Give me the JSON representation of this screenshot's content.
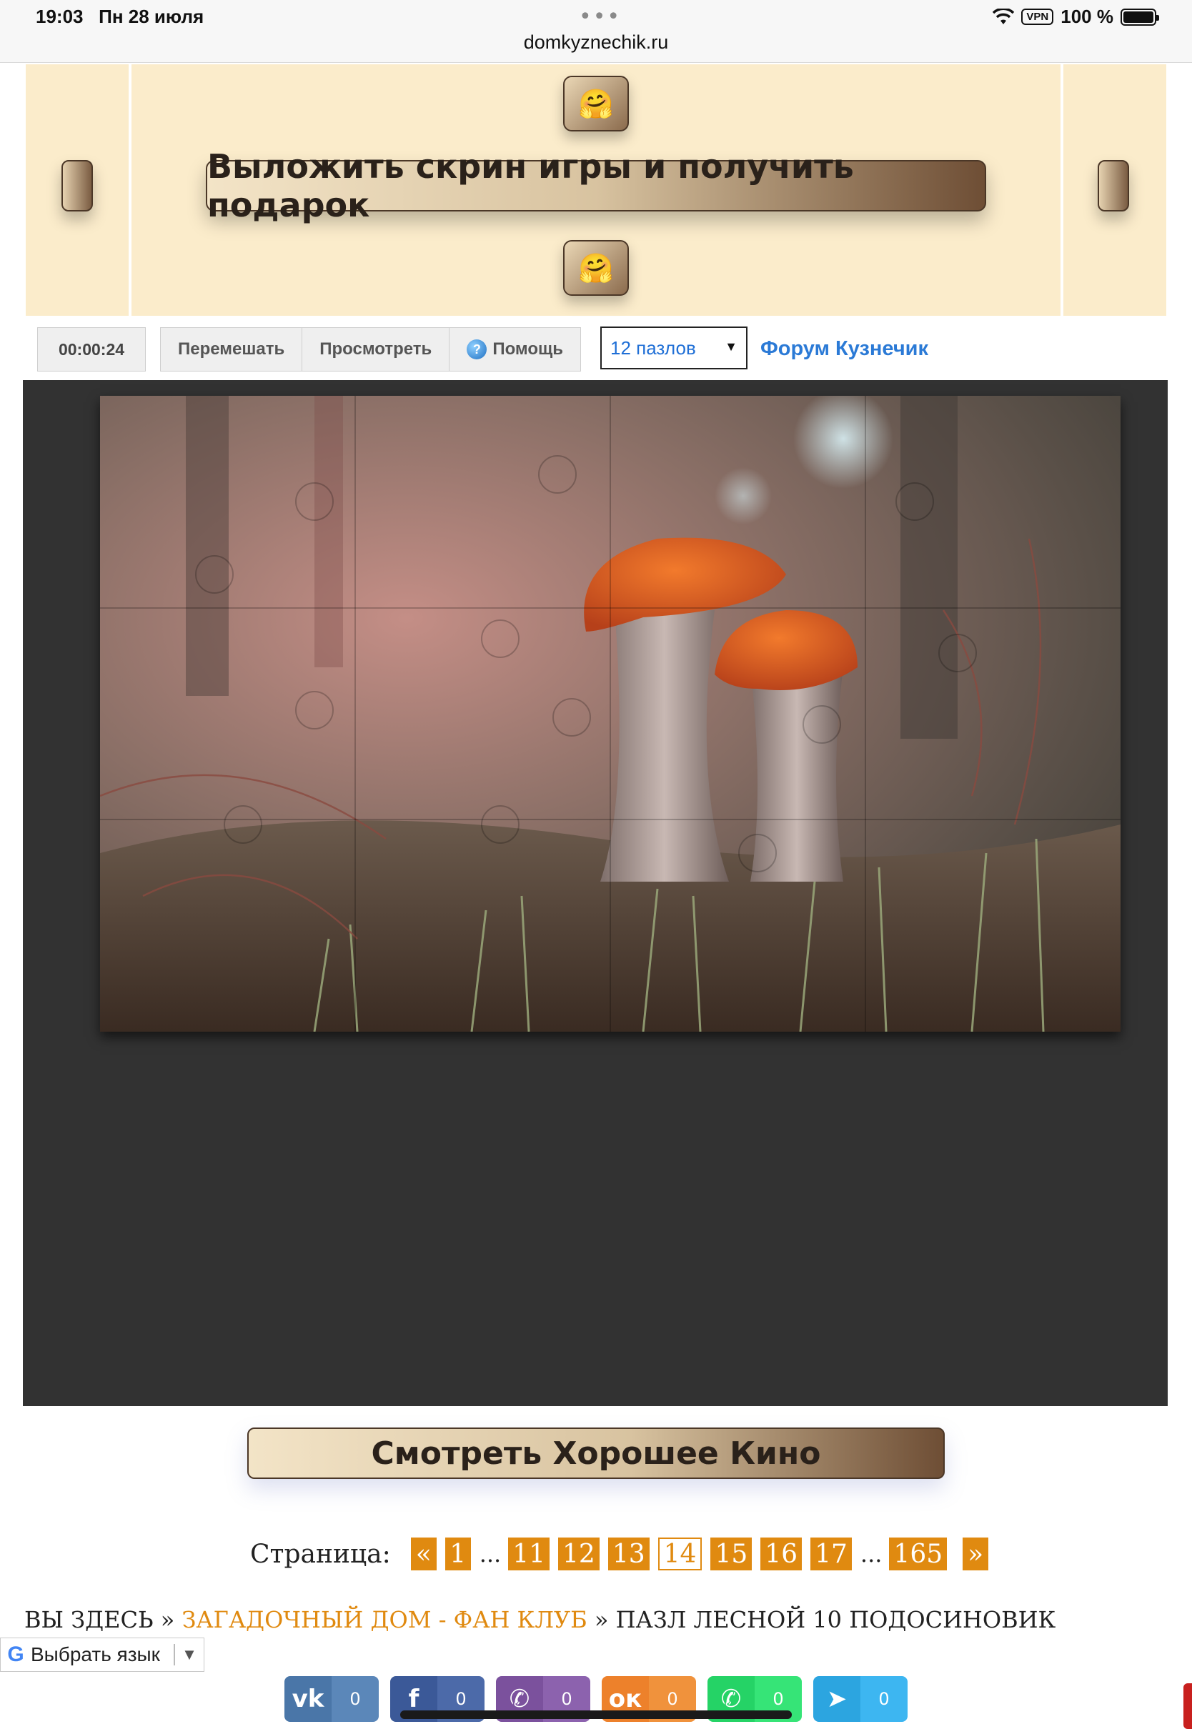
{
  "status_bar": {
    "time": "19:03",
    "date": "Пн 28 июля",
    "url": "domkyznechik.ru",
    "vpn": "VPN",
    "battery": "100 %"
  },
  "banner": {
    "emoji": "🤗",
    "button_label": "Выложить скрин игры и получить подарок"
  },
  "toolbar": {
    "timer": "00:00:24",
    "shuffle_label": "Перемешать",
    "preview_label": "Просмотреть",
    "help_label": "Помощь",
    "pieces_select": "12 пазлов",
    "forum_link": "Форум Кузнечик"
  },
  "bottom": {
    "kino_button": "Смотреть Хорошее Кино"
  },
  "pagination": {
    "label": "Страница:",
    "prev": "«",
    "next": "»",
    "ellipsis": "...",
    "pages": [
      "1",
      "11",
      "12",
      "13",
      "14",
      "15",
      "16",
      "17",
      "165"
    ],
    "current": "14"
  },
  "breadcrumb": {
    "prefix": "ВЫ ЗДЕСЬ",
    "separator": "»",
    "link": "ЗАГАДОЧНЫЙ ДОМ - ФАН КЛУБ",
    "current": "ПАЗЛ ЛЕСНОЙ 10 ПОДОСИНОВИК"
  },
  "language": {
    "label": "Выбрать язык"
  },
  "share_buttons": [
    {
      "network": "vk-icon",
      "icon_text": "vk",
      "count": "0",
      "color": "#4a76a8",
      "count_color": "#5b87b9"
    },
    {
      "network": "facebook-icon",
      "icon_text": "f",
      "count": "0",
      "color": "#3b5998",
      "count_color": "#4c6aa9"
    },
    {
      "network": "viber-icon",
      "icon_text": "✆",
      "count": "0",
      "color": "#7b519d",
      "count_color": "#8c62ae"
    },
    {
      "network": "odnoklassniki-icon",
      "icon_text": "ок",
      "count": "0",
      "color": "#ed812b",
      "count_color": "#f0923c"
    },
    {
      "network": "whatsapp-icon",
      "icon_text": "✆",
      "count": "0",
      "color": "#25d366",
      "count_color": "#36e477"
    },
    {
      "network": "telegram-icon",
      "icon_text": "➤",
      "count": "0",
      "color": "#2ca5e0",
      "count_color": "#3db6f1"
    }
  ],
  "colors": {
    "banner_bg": "#fbeccb",
    "puzzle_bg": "#323232",
    "accent_orange": "#e08a10",
    "link_blue": "#2b7ad6"
  }
}
